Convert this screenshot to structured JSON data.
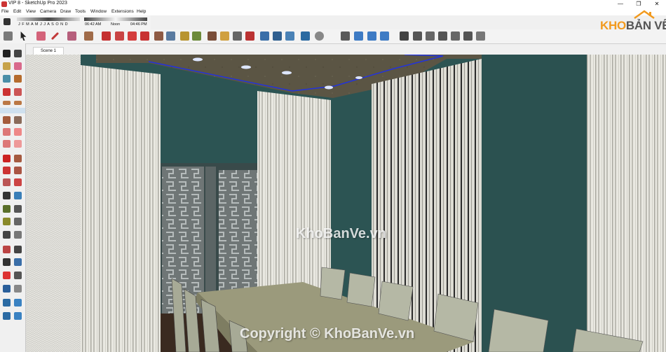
{
  "window": {
    "title": "VIP 8 - SketchUp Pro 2023",
    "controls": [
      "—",
      "❐",
      "✕"
    ]
  },
  "menu": [
    "File",
    "Edit",
    "View",
    "Camera",
    "Draw",
    "Tools",
    "Window",
    "Extensions",
    "Help"
  ],
  "shadow_settings": {
    "months": "J F M A M J J A S O N D",
    "time_start": "06:42 AM",
    "time_mid": "Noon",
    "time_end": "04:46 PM"
  },
  "scene_tab": "Scene 1",
  "logo": {
    "part1": "KHO",
    "part2": "BẢN VẼ"
  },
  "watermarks": {
    "center": "KhoBanVe.vn",
    "bottom": "Copyright © KhoBanVe.vn"
  },
  "colors": {
    "wall": "#2c5453",
    "curtain": "#ebeae3",
    "ceiling": "#5b5544",
    "accent_blue": "#2233dd",
    "logo_orange": "#f29a1e"
  }
}
